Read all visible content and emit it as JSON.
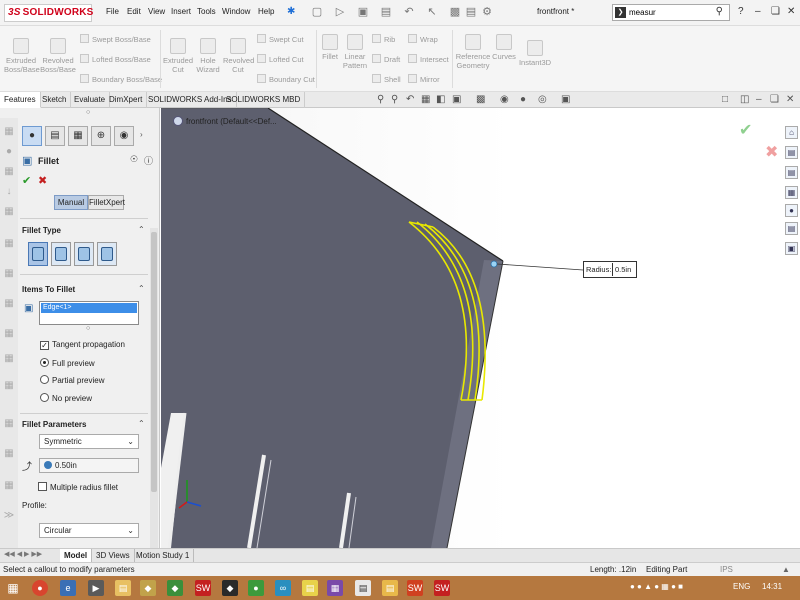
{
  "titlebar": {
    "logo_text": "SOLIDWORKS",
    "logo_prefix": "3S",
    "menus": [
      "File",
      "Edit",
      "View",
      "Insert",
      "Tools",
      "Window",
      "Help"
    ],
    "document_title": "frontfront *",
    "search_value": "measur",
    "help_label": "?"
  },
  "ribbon": {
    "extruded_boss": "Extruded\nBoss/Base",
    "revolved_boss": "Revolved\nBoss/Base",
    "swept_boss": "Swept Boss/Base",
    "lofted_boss": "Lofted Boss/Base",
    "boundary_boss": "Boundary Boss/Base",
    "extruded_cut": "Extruded\nCut",
    "hole_wizard": "Hole\nWizard",
    "revolved_cut": "Revolved\nCut",
    "swept_cut": "Swept Cut",
    "lofted_cut": "Lofted Cut",
    "boundary_cut": "Boundary Cut",
    "fillet": "Fillet",
    "linear_pattern": "Linear\nPattern",
    "rib": "Rib",
    "draft": "Draft",
    "shell": "Shell",
    "wrap": "Wrap",
    "intersect": "Intersect",
    "mirror": "Mirror",
    "reference_geometry": "Reference\nGeometry",
    "curves": "Curves",
    "instant3d": "Instant3D"
  },
  "tabs": [
    "Features",
    "Sketch",
    "Evaluate",
    "DimXpert",
    "SOLIDWORKS Add-Ins",
    "SOLIDWORKS MBD"
  ],
  "panel": {
    "title": "Fillet",
    "mode_buttons": [
      "Manual",
      "FilletXpert"
    ],
    "fillet_type_label": "Fillet Type",
    "items_label": "Items To Fillet",
    "selected_item": "Edge<1>",
    "tangent_propagation": "Tangent propagation",
    "full_preview": "Full preview",
    "partial_preview": "Partial preview",
    "no_preview": "No preview",
    "params_label": "Fillet Parameters",
    "symmetric": "Symmetric",
    "radius_value": "0.50in",
    "multiple_radius": "Multiple radius fillet",
    "profile_label": "Profile:",
    "profile_value": "Circular"
  },
  "viewport": {
    "tree_label": "frontfront  (Default<<Def...",
    "callout_label": "Radius:",
    "callout_value": "0.5in"
  },
  "bottom_tabs": [
    "Model",
    "3D Views",
    "Motion Study 1"
  ],
  "status": {
    "message": "Select a callout to modify parameters",
    "length": "Length: .12in",
    "mode": "Editing Part",
    "units": "IPS"
  },
  "taskbar": {
    "language": "ENG",
    "time": "14:31"
  },
  "colors": {
    "logo_red": "#d0021b",
    "taskbar": "#b5783f",
    "part_face": "#5d5f6e",
    "fillet_preview": "#e8e800",
    "accent_blue": "#3d8ee8"
  }
}
